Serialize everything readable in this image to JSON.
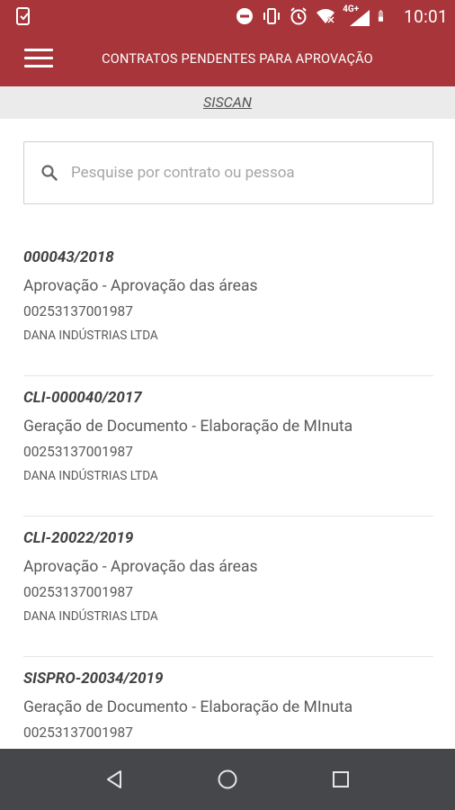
{
  "status_bar": {
    "network": "4G+",
    "time": "10:01"
  },
  "app_bar": {
    "title": "CONTRATOS PENDENTES PARA APROVAÇÃO"
  },
  "subbar": {
    "link": "SISCAN"
  },
  "search": {
    "placeholder": "Pesquise por contrato ou pessoa",
    "value": ""
  },
  "contracts": [
    {
      "code": "000043/2018",
      "stage": "Aprovação - Aprovação das áreas",
      "document": "00253137001987",
      "company": "DANA INDÚSTRIAS LTDA"
    },
    {
      "code": "CLI-000040/2017",
      "stage": "Geração de Documento - Elaboração de MInuta",
      "document": "00253137001987",
      "company": "DANA INDÚSTRIAS LTDA"
    },
    {
      "code": "CLI-20022/2019",
      "stage": "Aprovação - Aprovação das áreas",
      "document": "00253137001987",
      "company": "DANA INDÚSTRIAS LTDA"
    },
    {
      "code": "SISPRO-20034/2019",
      "stage": "Geração de Documento - Elaboração de MInuta",
      "document": "00253137001987",
      "company": ""
    }
  ],
  "colors": {
    "brand": "#a8353a",
    "subbar": "#ebebeb",
    "nav_bar": "#45474a"
  }
}
